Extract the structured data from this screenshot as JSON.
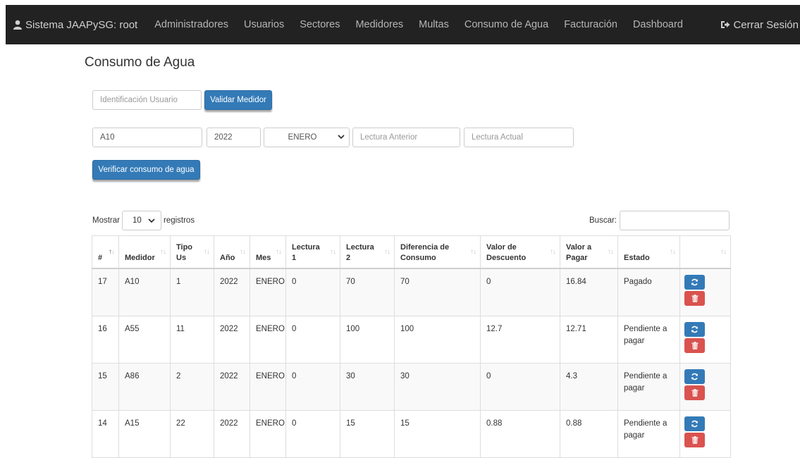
{
  "navbar": {
    "brand": "Sistema JAAPySG: root",
    "items": [
      "Administradores",
      "Usuarios",
      "Sectores",
      "Medidores",
      "Multas",
      "Consumo de Agua",
      "Facturación",
      "Dashboard"
    ],
    "logout": "Cerrar Sesión"
  },
  "page_title": "Consumo de Agua",
  "validate": {
    "id_placeholder": "Identificación Usuario",
    "button": "Validar Medidor"
  },
  "form": {
    "medidor": "A10",
    "anio": "2022",
    "mes": "ENERO",
    "lectura_anterior_placeholder": "Lectura Anterior",
    "lectura_actual_placeholder": "Lectura Actual",
    "verify_button": "Verificar consumo de agua"
  },
  "table_controls": {
    "show_label": "Mostrar",
    "length_value": "10",
    "records_label": "registros",
    "search_label": "Buscar:"
  },
  "table": {
    "headers": [
      "#",
      "Medidor",
      "Tipo Us",
      "Año",
      "Mes",
      "Lectura 1",
      "Lectura 2",
      "Diferencia de Consumo",
      "Valor de Descuento",
      "Valor a Pagar",
      "Estado",
      ""
    ],
    "rows": [
      [
        "17",
        "A10",
        "1",
        "2022",
        "ENERO",
        "0",
        "70",
        "70",
        "0",
        "16.84",
        "Pagado"
      ],
      [
        "16",
        "A55",
        "11",
        "2022",
        "ENERO",
        "0",
        "100",
        "100",
        "12.7",
        "12.71",
        "Pendiente a pagar"
      ],
      [
        "15",
        "A86",
        "2",
        "2022",
        "ENERO",
        "0",
        "30",
        "30",
        "0",
        "4.3",
        "Pendiente a pagar"
      ],
      [
        "14",
        "A15",
        "22",
        "2022",
        "ENERO",
        "0",
        "15",
        "15",
        "0.88",
        "0.88",
        "Pendiente a pagar"
      ]
    ]
  },
  "icons": {
    "brand": "user-icon",
    "logout": "sign-out-icon",
    "update": "refresh-icon",
    "delete": "trash-icon"
  },
  "colors": {
    "navbar_bg": "#222222",
    "primary": "#337ab7",
    "danger": "#d9534f"
  }
}
